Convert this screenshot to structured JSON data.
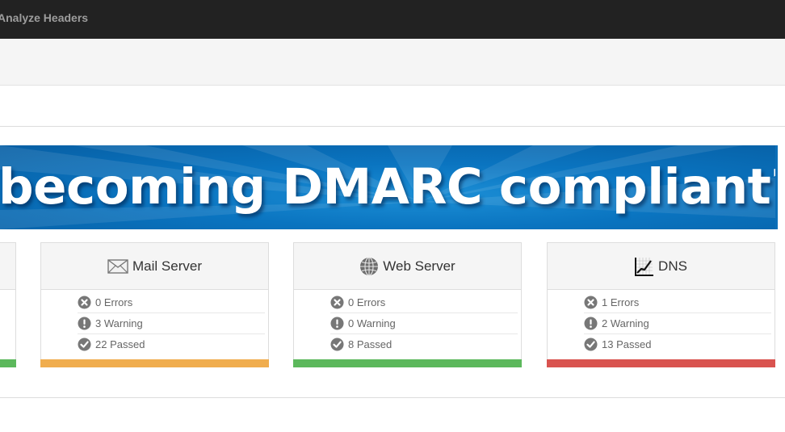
{
  "topbar": {
    "nav_label": "Analyze Headers"
  },
  "banner": {
    "headline": "becoming DMARC compliant?"
  },
  "cards": [
    {
      "title": "Mail Server",
      "icon": "envelope-icon",
      "status_color": "#f0ad4e",
      "stats": [
        {
          "icon": "error-icon",
          "text": "0 Errors"
        },
        {
          "icon": "warning-icon",
          "text": "3 Warning"
        },
        {
          "icon": "passed-icon",
          "text": "22 Passed"
        }
      ]
    },
    {
      "title": "Web Server",
      "icon": "globe-icon",
      "status_color": "#5cb85c",
      "stats": [
        {
          "icon": "error-icon",
          "text": "0 Errors"
        },
        {
          "icon": "warning-icon",
          "text": "0 Warning"
        },
        {
          "icon": "passed-icon",
          "text": "8 Passed"
        }
      ]
    },
    {
      "title": "DNS",
      "icon": "chart-icon",
      "status_color": "#d9534f",
      "stats": [
        {
          "icon": "error-icon",
          "text": "1 Errors"
        },
        {
          "icon": "warning-icon",
          "text": "2 Warning"
        },
        {
          "icon": "passed-icon",
          "text": "13 Passed"
        }
      ]
    }
  ],
  "partial_card": {
    "status_color": "#5cb85c"
  },
  "colors": {
    "topbar": "#222222",
    "banner": "#0a74c0",
    "stat_icon": "#777777"
  }
}
